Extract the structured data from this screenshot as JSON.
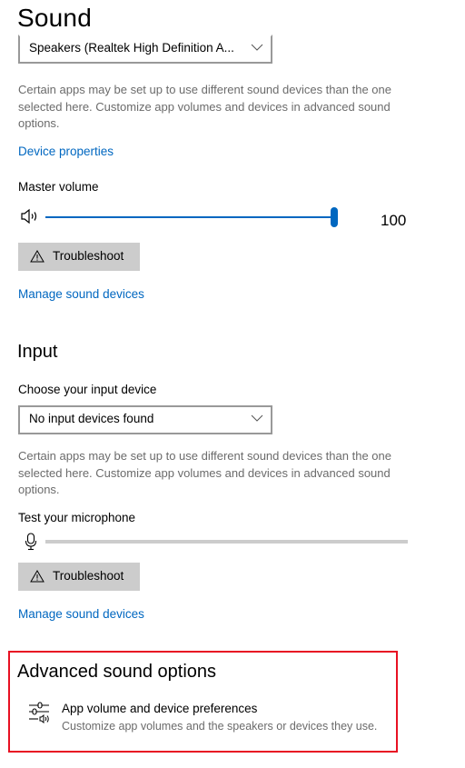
{
  "output": {
    "title": "Sound",
    "device_select": {
      "value": "Speakers (Realtek High Definition A..."
    },
    "description": "Certain apps may be set up to use different sound devices than the one selected here. Customize app volumes and devices in advanced sound options.",
    "device_properties_link": "Device properties",
    "master_volume_label": "Master volume",
    "master_volume_value": "100",
    "master_volume_percent": 100,
    "troubleshoot_label": "Troubleshoot",
    "manage_devices_link": "Manage sound devices"
  },
  "input": {
    "title": "Input",
    "choose_label": "Choose your input device",
    "device_select": {
      "value": "No input devices found"
    },
    "description": "Certain apps may be set up to use different sound devices than the one selected here. Customize app volumes and devices in advanced sound options.",
    "test_mic_label": "Test your microphone",
    "mic_level_percent": 0,
    "troubleshoot_label": "Troubleshoot",
    "manage_devices_link": "Manage sound devices"
  },
  "advanced": {
    "title": "Advanced sound options",
    "item_title": "App volume and device preferences",
    "item_subtitle": "Customize app volumes and the speakers or devices they use."
  },
  "colors": {
    "accent": "#0067c0",
    "highlight_border": "#e81123",
    "button_bg": "#cccccc"
  }
}
